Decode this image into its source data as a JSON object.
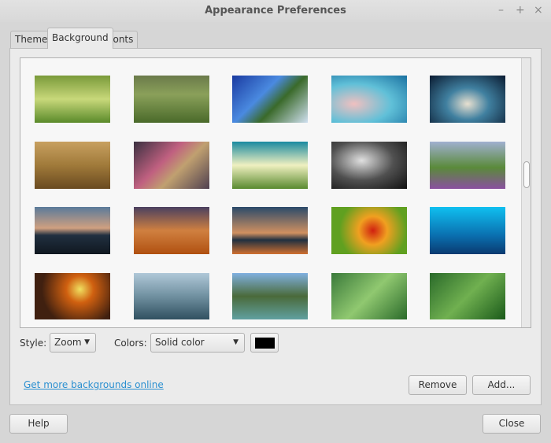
{
  "window": {
    "title": "Appearance Preferences",
    "controls": [
      "–",
      "+",
      "×"
    ]
  },
  "tabs": [
    {
      "label": "Theme"
    },
    {
      "label": "Background"
    },
    {
      "label": "Fonts"
    }
  ],
  "active_tab": "Background",
  "options": {
    "style_label": "Style:",
    "style_value": "Zoom",
    "colors_label": "Colors:",
    "colors_value": "Solid color",
    "color_swatch": "#000000"
  },
  "link": "Get more backgrounds online",
  "buttons": {
    "remove": "Remove",
    "add": "Add...",
    "help": "Help",
    "close": "Close"
  }
}
